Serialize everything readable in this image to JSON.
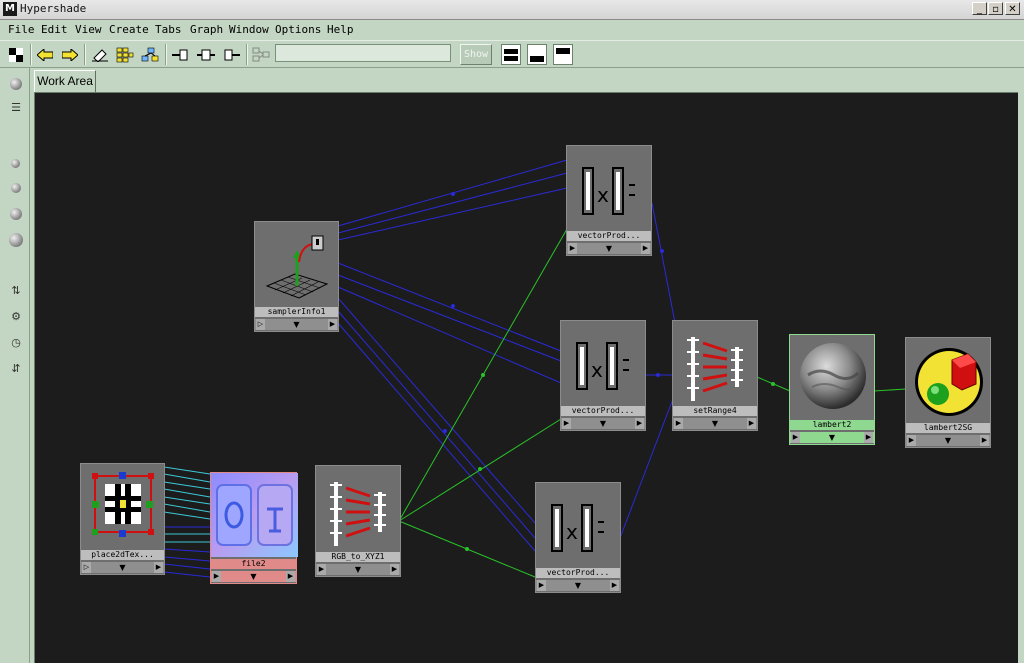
{
  "window": {
    "title": "Hypershade",
    "app_icon_glyph": "M",
    "controls": {
      "minimize": "_",
      "restore": "▫",
      "close": "✕"
    }
  },
  "menu": {
    "items": [
      "File",
      "Edit",
      "View",
      "Create",
      "Tabs",
      "Graph",
      "Window",
      "Options",
      "Help"
    ]
  },
  "toolbar": {
    "show_label": "Show",
    "search_value": "",
    "icons": [
      "checker-icon",
      "back-arrow-icon",
      "forward-arrow-icon",
      "eraser-icon",
      "graph-layout-icon",
      "graph-network-icon",
      "input-connections-icon",
      "input-output-connections-icon",
      "output-connections-icon",
      "filter-icon"
    ]
  },
  "tabs": {
    "work_area": "Work Area"
  },
  "nodes": {
    "samplerInfo": {
      "label": "samplerInfo1"
    },
    "vectorProd_top": {
      "label": "vectorProd..."
    },
    "vectorProd_mid": {
      "label": "vectorProd..."
    },
    "vectorProd_bot": {
      "label": "vectorProd..."
    },
    "setRange": {
      "label": "setRange4"
    },
    "lambert": {
      "label": "lambert2"
    },
    "lambertSG": {
      "label": "lambert2SG"
    },
    "place2d": {
      "label": "place2dTex..."
    },
    "file": {
      "label": "file2"
    },
    "rgbToXyz": {
      "label": "RGB_to_XYZ1"
    }
  },
  "node_icons": {
    "samplerInfo": "sampler-info-icon",
    "vectorProd": "vector-product-icon",
    "setRange": "set-range-icon",
    "lambert": "lambert-sphere-icon",
    "lambertSG": "shading-group-icon",
    "place2d": "place2d-texture-icon",
    "file": "file-texture-icon",
    "rgbToXyz": "rgb-to-xyz-icon"
  },
  "colors": {
    "workarea_bg": "#1c1c1c",
    "node_bg": "#6e6e6e",
    "wire_blue": "#2a2ad8",
    "wire_green": "#29c229",
    "wire_cyan": "#3cc8d8",
    "lambert_label_bg": "#8fd88f",
    "file_label_bg": "#e08a8a"
  },
  "port_glyphs": {
    "left": "▷",
    "mid": "▼",
    "right": "▶"
  }
}
